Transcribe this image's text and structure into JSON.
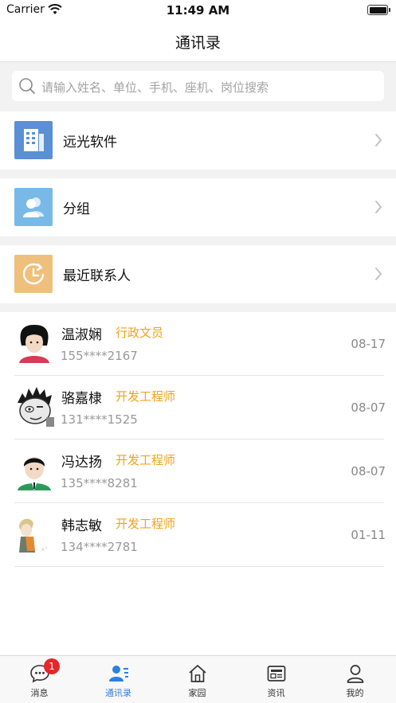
{
  "status_bar": {
    "carrier": "Carrier",
    "time": "11:49 AM"
  },
  "nav": {
    "title": "通讯录"
  },
  "search": {
    "placeholder": "请输入姓名、单位、手机、座机、岗位搜索"
  },
  "categories": [
    {
      "label": "远光软件",
      "icon": "building-icon",
      "color": "#5b8fd6"
    },
    {
      "label": "分组",
      "icon": "group-icon",
      "color": "#78b9e8"
    },
    {
      "label": "最近联系人",
      "icon": "clock-icon",
      "color": "#efbf7c"
    }
  ],
  "contacts": [
    {
      "name": "温淑娴",
      "title": "行政文员",
      "phone": "155****2167",
      "date": "08-17",
      "avatar": "female-avatar-icon"
    },
    {
      "name": "骆嘉棣",
      "title": "开发工程师",
      "phone": "131****1525",
      "date": "08-07",
      "avatar": "spiky-hair-avatar-icon"
    },
    {
      "name": "冯达扬",
      "title": "开发工程师",
      "phone": "135****8281",
      "date": "08-07",
      "avatar": "male-avatar-icon"
    },
    {
      "name": "韩志敏",
      "title": "开发工程师",
      "phone": "134****2781",
      "date": "01-11",
      "avatar": "anime-avatar-icon"
    }
  ],
  "tabbar": {
    "tabs": [
      {
        "label": "消息",
        "icon": "chat-icon",
        "badge": "1"
      },
      {
        "label": "通讯录",
        "icon": "contacts-icon",
        "active": true
      },
      {
        "label": "家园",
        "icon": "home-icon"
      },
      {
        "label": "资讯",
        "icon": "news-icon"
      },
      {
        "label": "我的",
        "icon": "person-icon"
      }
    ]
  },
  "colors": {
    "accent": "#2d7fe0",
    "job_title": "#f2a21a",
    "badge": "#e6262b"
  }
}
